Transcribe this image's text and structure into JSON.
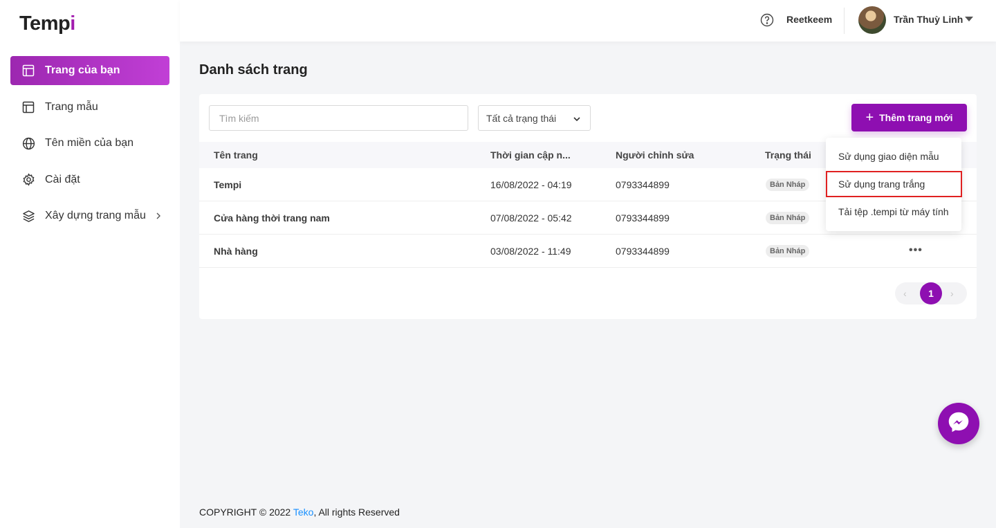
{
  "app": {
    "logo_main": "Temp",
    "logo_accent": "i"
  },
  "sidebar": {
    "items": [
      {
        "label": "Trang của bạn",
        "icon": "layout-icon",
        "active": true
      },
      {
        "label": "Trang mẫu",
        "icon": "layout-icon",
        "active": false
      },
      {
        "label": "Tên miền của bạn",
        "icon": "globe-icon",
        "active": false
      },
      {
        "label": "Cài đặt",
        "icon": "gear-icon",
        "active": false
      },
      {
        "label": "Xây dựng trang mẫu",
        "icon": "layers-icon",
        "active": false,
        "has_submenu": true
      }
    ]
  },
  "header": {
    "workspace": "Reetkeem",
    "user_name": "Trần Thuỳ Linh"
  },
  "main": {
    "title": "Danh sách trang",
    "search_placeholder": "Tìm kiếm",
    "status_filter": "Tất cả trạng thái",
    "add_button": "Thêm trang mới",
    "columns": [
      "Tên trang",
      "Thời gian cập n...",
      "Người chỉnh sửa",
      "Trạng thái"
    ],
    "rows": [
      {
        "name": "Tempi",
        "updated": "16/08/2022 - 04:19",
        "editor": "0793344899",
        "status": "Bản Nháp"
      },
      {
        "name": "Cửa hàng thời trang nam",
        "updated": "07/08/2022 - 05:42",
        "editor": "0793344899",
        "status": "Bản Nháp"
      },
      {
        "name": "Nhà hàng",
        "updated": "03/08/2022 - 11:49",
        "editor": "0793344899",
        "status": "Bản Nháp"
      }
    ],
    "pagination": {
      "current": "1",
      "prev": "‹",
      "next": "›"
    }
  },
  "add_menu": {
    "items": [
      "Sử dụng giao diện mẫu",
      "Sử dụng trang trắng",
      "Tải tệp .tempi từ máy tính"
    ],
    "highlighted_index": 1
  },
  "footer": {
    "prefix": "COPYRIGHT © 2022 ",
    "link": "Teko",
    "suffix": ", All rights Reserved"
  },
  "colors": {
    "brand": "#8e0fb1",
    "highlight_border": "#e02020",
    "link": "#1890ff"
  }
}
